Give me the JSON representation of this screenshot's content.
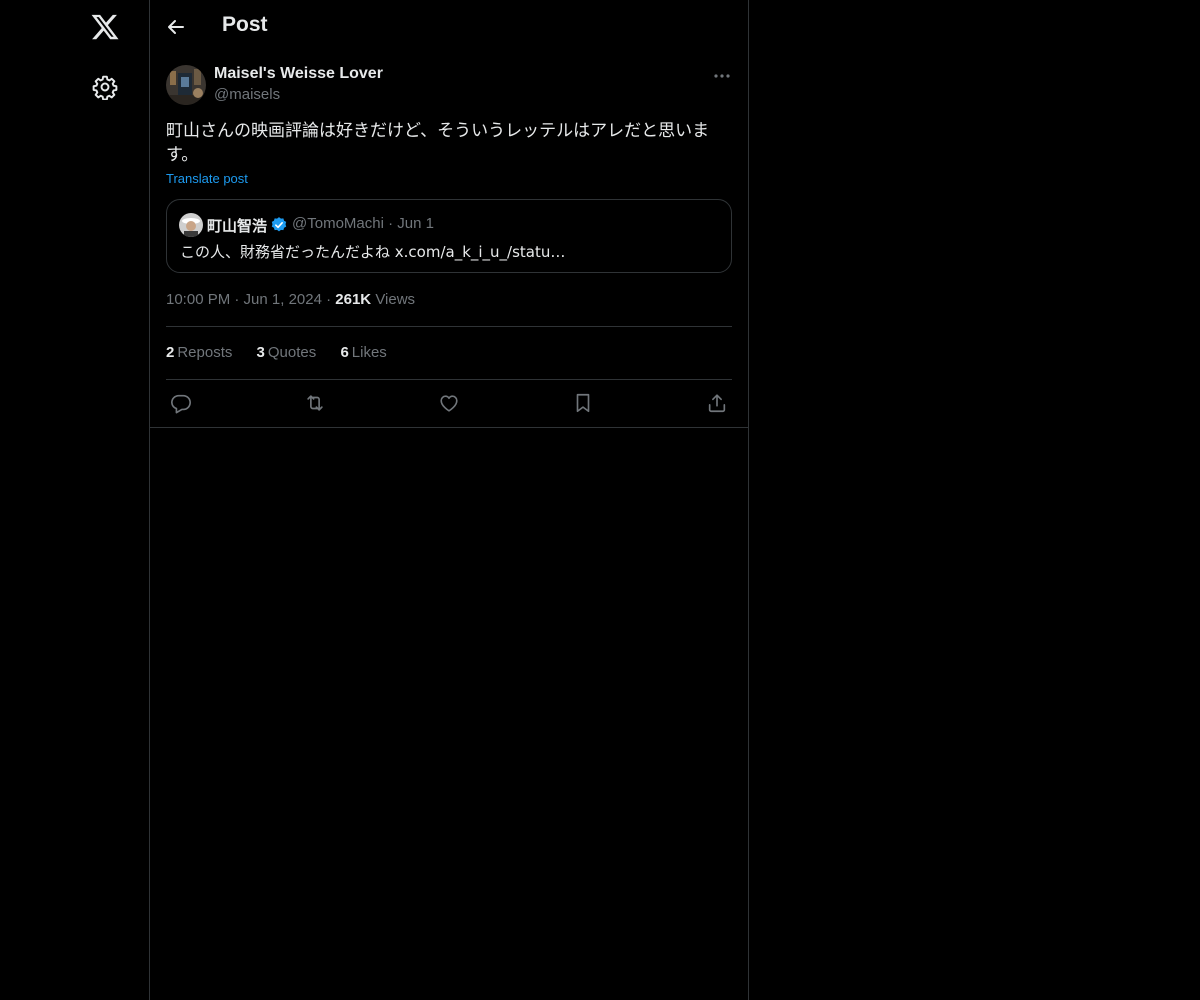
{
  "nav": {
    "logo_icon": "x-logo-icon",
    "settings_icon": "gear-icon"
  },
  "header": {
    "back_icon": "arrow-left-icon",
    "title": "Post"
  },
  "post": {
    "author": {
      "display_name": "Maisel's Weisse Lover",
      "handle": "@maisels"
    },
    "text": "町山さんの映画評論は好きだけど、そういうレッテルはアレだと思います。",
    "translate_label": "Translate post",
    "quote": {
      "name": "町山智浩",
      "handle_date": "@TomoMachi · Jun 1",
      "text": "この人、財務省だったんだよね x.com/a_k_i_u_/statu…"
    },
    "meta": {
      "time_date": "10:00 PM · Jun 1, 2024 ·",
      "views_count": "261K",
      "views_label": "Views"
    },
    "stats": {
      "reposts_count": "2",
      "reposts_label": "Reposts",
      "quotes_count": "3",
      "quotes_label": "Quotes",
      "likes_count": "6",
      "likes_label": "Likes"
    }
  },
  "actions": [
    "reply-icon",
    "repost-icon",
    "like-icon",
    "bookmark-icon",
    "share-icon"
  ],
  "colors": {
    "background": "#000000",
    "border": "#2f3336",
    "text": "#e7e9ea",
    "muted": "#71767b",
    "accent": "#1d9bf0"
  }
}
